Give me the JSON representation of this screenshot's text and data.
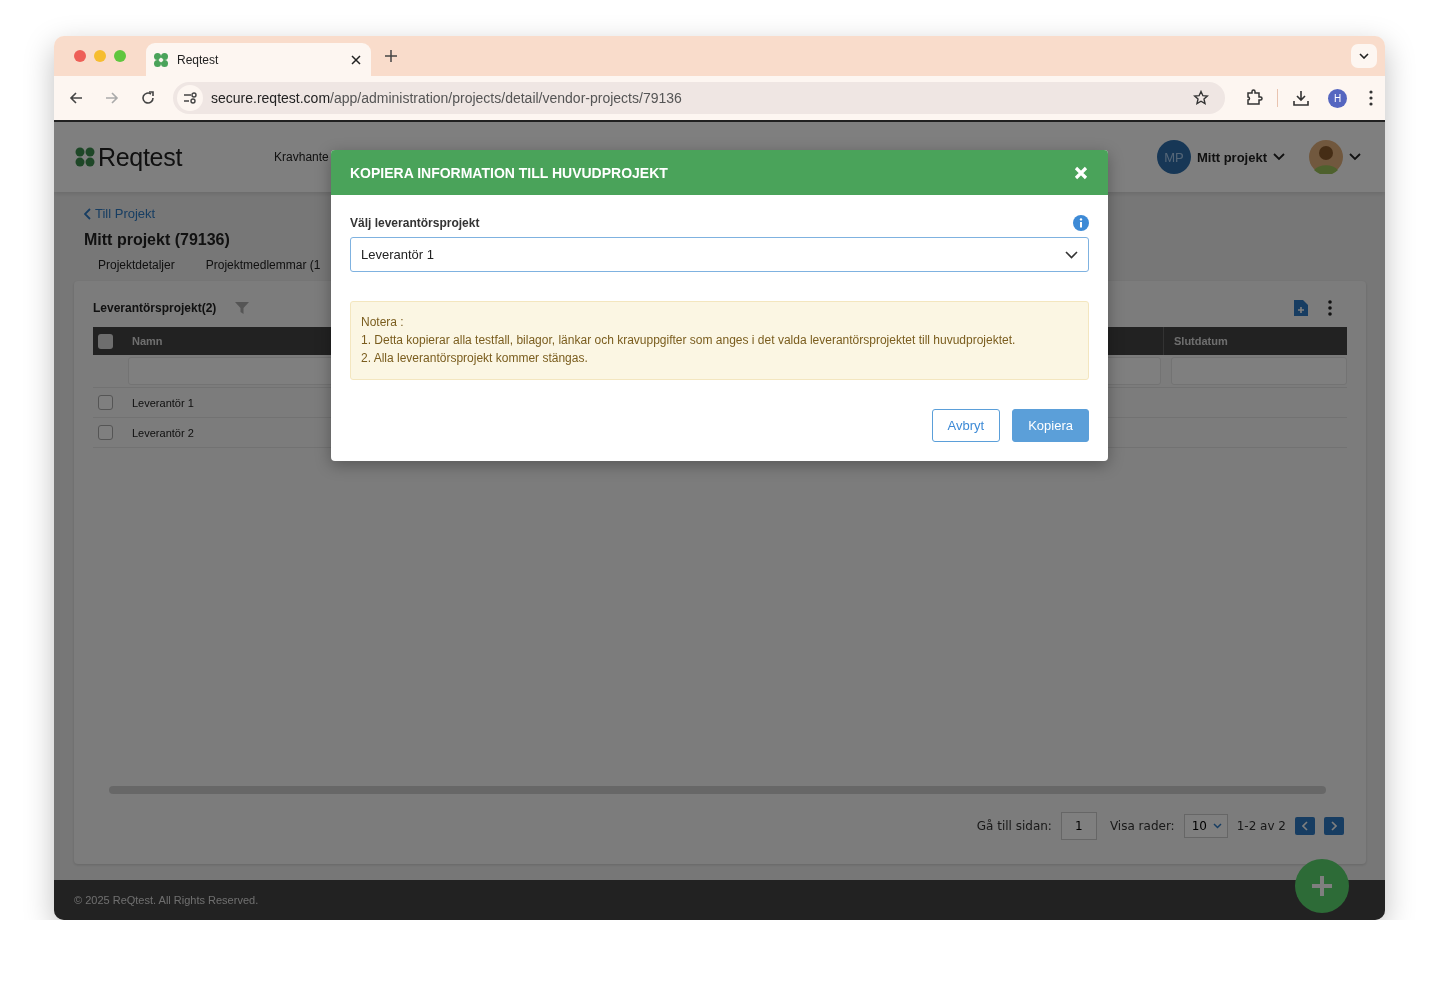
{
  "browser": {
    "tab_title": "Reqtest",
    "url_host": "secure.reqtest.com",
    "url_path": "/app/administration/projects/detail/vendor-projects/79136",
    "profile_letter": "H"
  },
  "header": {
    "logo": "Reqtest",
    "nav": [
      "Kravhante"
    ],
    "project": {
      "initials": "MP",
      "label": "Mitt projekt"
    }
  },
  "back_link": "Till Projekt",
  "title": "Mitt projekt (79136)",
  "tabs": [
    {
      "label": "Projektdetaljer",
      "selected": false
    },
    {
      "label": "Projektmedlemmar (1",
      "selected": false
    }
  ],
  "card": {
    "title": "Leverantörsprojekt(2)",
    "select_all": {
      "checked": false
    },
    "columns": [
      {
        "label": "Namn"
      },
      {
        "label": "Slutdatum"
      }
    ],
    "rows": [
      {
        "name": "Leverantör 1",
        "checked": false
      },
      {
        "name": "Leverantör 2",
        "checked": false
      }
    ],
    "pagination": {
      "goto_label": "Gå till sidan:",
      "page": "1",
      "rows_label": "Visa rader:",
      "rows_value": "10",
      "range": "1-2 av 2"
    }
  },
  "footer": "© 2025 ReQtest. All Rights Reserved.",
  "modal": {
    "title": "KOPIERA INFORMATION TILL HUVUDPROJEKT",
    "field_label": "Välj leverantörsprojekt",
    "value": "Leverantör 1",
    "note": [
      "Notera :",
      "1. Detta kopierar alla testfall, bilagor, länkar och kravuppgifter som anges i det valda leverantörsprojektet till huvudprojektet.",
      "2. Alla leverantörsprojekt kommer stängas."
    ],
    "buttons": [
      {
        "label": "Avbryt",
        "kind": "secondary"
      },
      {
        "label": "Kopiera",
        "kind": "primary"
      }
    ]
  }
}
